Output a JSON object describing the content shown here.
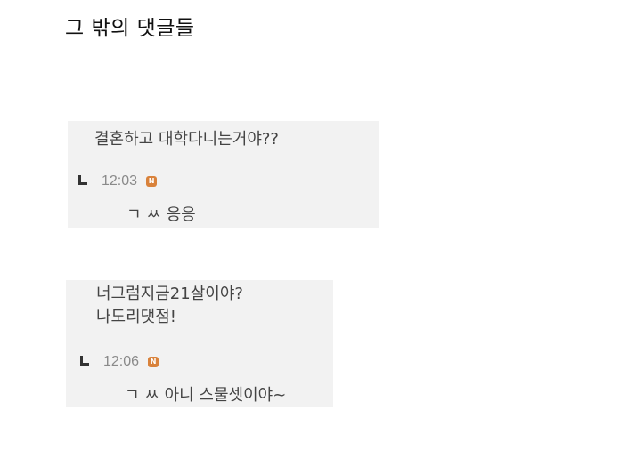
{
  "page": {
    "title": "그 밖의 댓글들"
  },
  "comments": [
    {
      "text": "결혼하고 대학다니는거야??",
      "reply": {
        "time": "12:03",
        "badge": "N",
        "text": "ㄱ ㅆ 응응"
      }
    },
    {
      "text": "너그럼지금21살이야?\n나도리댓점!",
      "reply": {
        "time": "12:06",
        "badge": "N",
        "text": "ㄱ ㅆ 아니 스물셋이야~"
      }
    }
  ],
  "colors": {
    "box_background": "#f2f2f2",
    "badge": "#d9823b",
    "time_text": "#8a8a8a"
  },
  "icons": {
    "reply_arrow": "reply-arrow-icon",
    "new_badge": "new-badge-icon"
  }
}
